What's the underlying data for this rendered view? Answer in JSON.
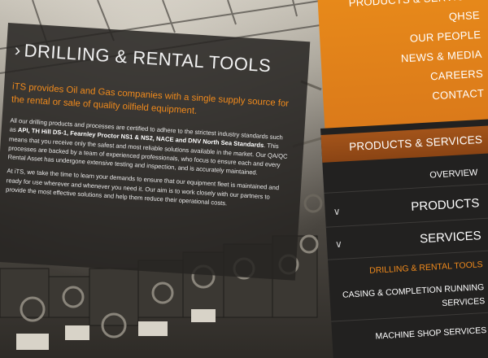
{
  "top_menu": [
    "PRODUCTS & SERVICES",
    "QHSE",
    "OUR PEOPLE",
    "NEWS & MEDIA",
    "CAREERS",
    "CONTACT"
  ],
  "subnav": {
    "header": "PRODUCTS & SERVICES",
    "overview": "OVERVIEW",
    "products": "PRODUCTS",
    "services": "SERVICES",
    "drilling": "DRILLING & RENTAL TOOLS",
    "casing": "CASING & COMPLETION RUNNING SERVICES",
    "machine": "MACHINE SHOP SERVICES"
  },
  "panel": {
    "title": "DRILLING & RENTAL TOOLS",
    "lead": "iTS provides Oil and Gas companies with a single supply source for the rental or sale of quality oilfield equipment.",
    "p1_a": "All our drilling products and processes are certified to adhere to the strictest industry standards such as ",
    "p1_b": "API, TH Hill DS-1, Fearnley Proctor NS1 & NS2, NACE and DNV North Sea Standards",
    "p1_c": ". This means that you receive only the safest and most reliable solutions available in the market. Our QA/QC processes are backed by a team of experienced professionals, who focus to ensure each and every Rental Asset has undergone extensive testing and inspection, and is accurately maintained.",
    "p2": "At iTS, we take the time to learn your demands to ensure that our equipment fleet is maintained and ready for use wherever and whenever you need it. Our aim is to work closely with our partners to provide the most effective solutions and help them reduce their operational costs."
  },
  "colors": {
    "accent_orange": "#f08a1c",
    "nav_orange": "#e0801a",
    "nav_dark": "#222120"
  }
}
